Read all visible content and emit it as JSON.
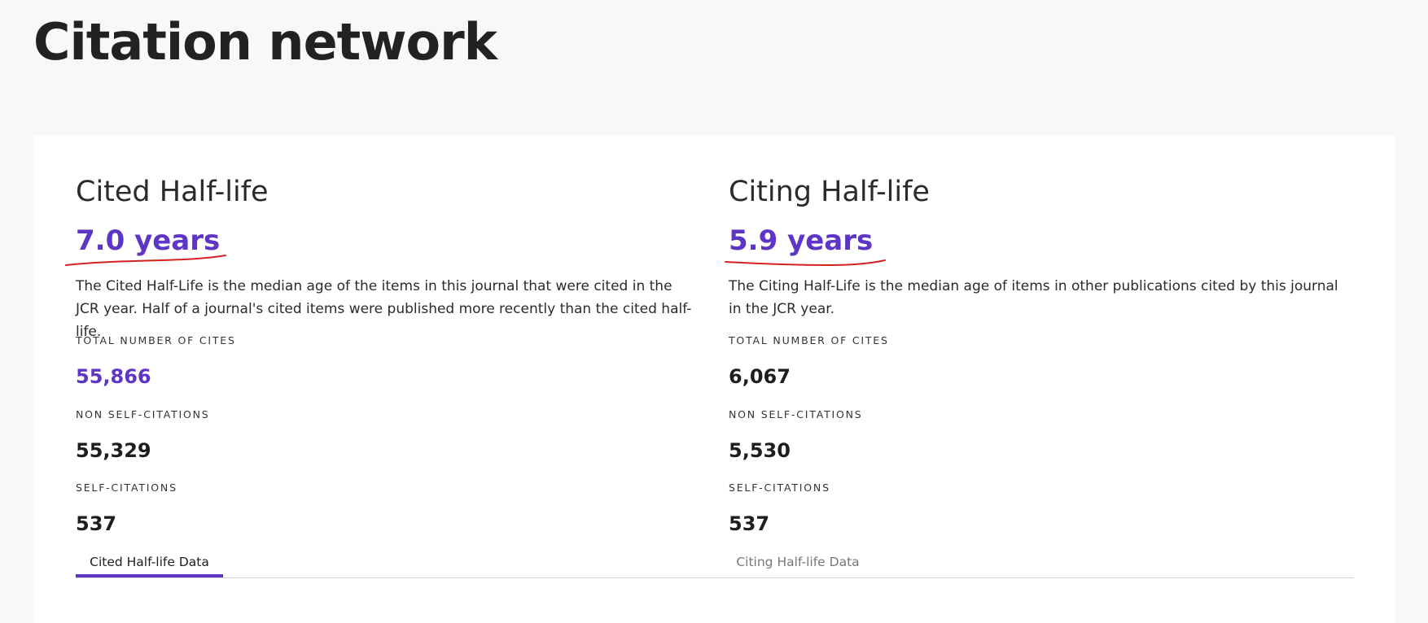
{
  "page": {
    "title": "Citation network"
  },
  "cited": {
    "heading": "Cited Half-life",
    "value": "7.0 years",
    "description": "The Cited Half-Life is the median age of the items in this journal that were cited in the JCR year. Half of a journal's cited items were published more recently than the cited half-life.",
    "total_label": "TOTAL NUMBER OF CITES",
    "total_value": "55,866",
    "non_self_label": "NON SELF-CITATIONS",
    "non_self_value": "55,329",
    "self_label": "SELF-CITATIONS",
    "self_value": "537"
  },
  "citing": {
    "heading": "Citing Half-life",
    "value": "5.9 years",
    "description": "The Citing Half-Life is the median age of items in other publications cited by this journal in the JCR year.",
    "total_label": "TOTAL NUMBER OF CITES",
    "total_value": "6,067",
    "non_self_label": "NON SELF-CITATIONS",
    "non_self_value": "5,530",
    "self_label": "SELF-CITATIONS",
    "self_value": "537"
  },
  "tabs": [
    {
      "label": "Cited Half-life Data",
      "active": true
    },
    {
      "label": "Citing Half-life Data",
      "active": false
    }
  ],
  "colors": {
    "accent": "#5e35c4",
    "annotation": "#d42020",
    "background": "#f8f8f8",
    "card": "#ffffff"
  }
}
